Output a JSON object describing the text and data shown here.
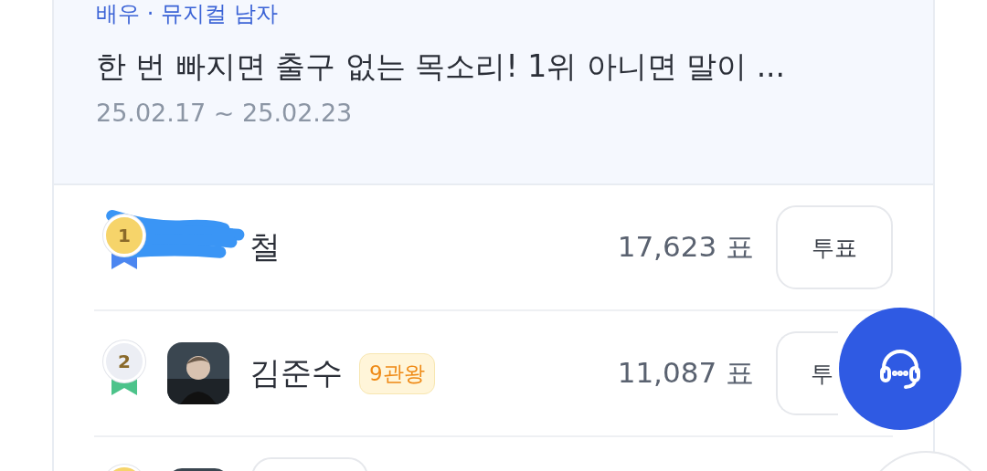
{
  "header": {
    "category": "배우 · 뮤지컬 남자",
    "title": "한 번 빠지면 출구 없는 목소리! 1위 아니면 말이 ...",
    "period": "25.02.17 ~ 25.02.23"
  },
  "rows": [
    {
      "rank": "1",
      "medal": {
        "color": "#f6d46a"
      },
      "ribbon": {
        "color": "#4b86f0"
      },
      "name": "철",
      "redacted": true,
      "votes": "17,623 표",
      "button": "투표"
    },
    {
      "rank": "2",
      "medal": {
        "color": "#eceef4"
      },
      "ribbon": {
        "color": "#4cc38a"
      },
      "name": "김준수",
      "badge": "9관왕",
      "votes": "11,087 표",
      "button": "투"
    },
    {
      "medal": {
        "color": "#f6d46a"
      }
    }
  ],
  "fab": {
    "kind": "support"
  }
}
